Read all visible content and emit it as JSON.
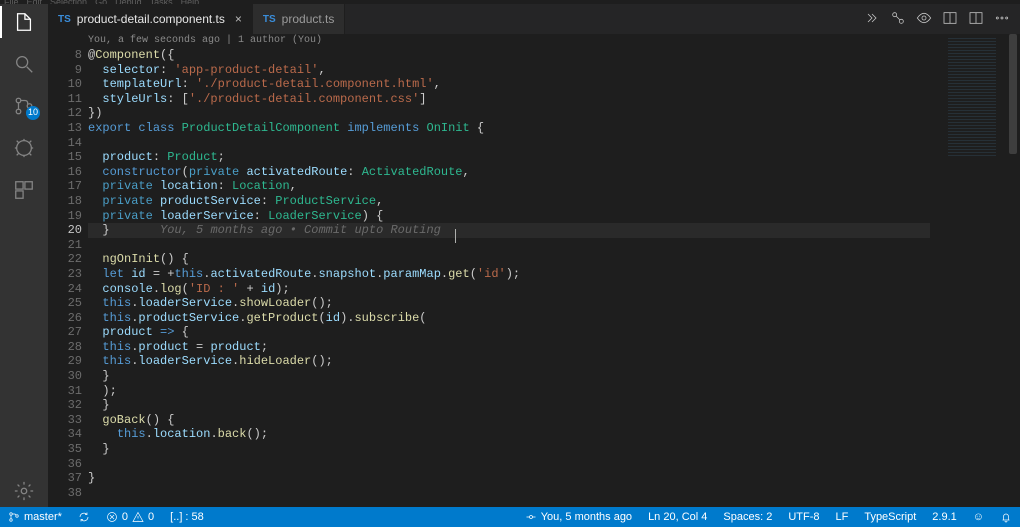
{
  "menu": [
    "File",
    "Edit",
    "Selection",
    "Go",
    "Debug",
    "Tasks",
    "Help"
  ],
  "activity_badge": "10",
  "tabs": [
    {
      "icon": "TS",
      "label": "product-detail.component.ts",
      "active": true
    },
    {
      "icon": "TS",
      "label": "product.ts",
      "active": false
    }
  ],
  "blame_top": "You, a few seconds ago | 1 author (You)",
  "cursor_blame": "You, 5 months ago • Commit upto Routing",
  "gutter_start": 8,
  "current_line": 20,
  "code": {
    "r8": [
      [
        "p",
        "@"
      ],
      [
        "fn",
        "Component"
      ],
      [
        "p",
        "({"
      ]
    ],
    "r9": [
      [
        "p",
        "  "
      ],
      [
        "id",
        "selector"
      ],
      [
        "p",
        ": "
      ],
      [
        "st",
        "'app-product-detail'"
      ],
      [
        "p",
        ","
      ]
    ],
    "r10": [
      [
        "p",
        "  "
      ],
      [
        "id",
        "templateUrl"
      ],
      [
        "p",
        ": "
      ],
      [
        "st",
        "'./product-detail.component.html'"
      ],
      [
        "p",
        ","
      ]
    ],
    "r11": [
      [
        "p",
        "  "
      ],
      [
        "id",
        "styleUrls"
      ],
      [
        "p",
        ": ["
      ],
      [
        "st",
        "'./product-detail.component.css'"
      ],
      [
        "p",
        "]"
      ]
    ],
    "r12": [
      [
        "p",
        "})"
      ]
    ],
    "r13": [
      [
        "k",
        "export"
      ],
      [
        "p",
        " "
      ],
      [
        "k",
        "class"
      ],
      [
        "p",
        " "
      ],
      [
        "cl",
        "ProductDetailComponent"
      ],
      [
        "p",
        " "
      ],
      [
        "k",
        "implements"
      ],
      [
        "p",
        " "
      ],
      [
        "cl",
        "OnInit"
      ],
      [
        "p",
        " {"
      ]
    ],
    "r14": [
      [
        "p",
        ""
      ]
    ],
    "r15": [
      [
        "p",
        "  "
      ],
      [
        "id",
        "product"
      ],
      [
        "p",
        ": "
      ],
      [
        "cl",
        "Product"
      ],
      [
        "p",
        ";"
      ]
    ],
    "r16": [
      [
        "p",
        "  "
      ],
      [
        "k",
        "constructor"
      ],
      [
        "p",
        "("
      ],
      [
        "kw",
        "private"
      ],
      [
        "p",
        " "
      ],
      [
        "id",
        "activatedRoute"
      ],
      [
        "p",
        ": "
      ],
      [
        "cl",
        "ActivatedRoute"
      ],
      [
        "p",
        ","
      ]
    ],
    "r17": [
      [
        "p",
        "  "
      ],
      [
        "kw",
        "private"
      ],
      [
        "p",
        " "
      ],
      [
        "id",
        "location"
      ],
      [
        "p",
        ": "
      ],
      [
        "cl",
        "Location"
      ],
      [
        "p",
        ","
      ]
    ],
    "r18": [
      [
        "p",
        "  "
      ],
      [
        "kw",
        "private"
      ],
      [
        "p",
        " "
      ],
      [
        "id",
        "productService"
      ],
      [
        "p",
        ": "
      ],
      [
        "cl",
        "ProductService"
      ],
      [
        "p",
        ","
      ]
    ],
    "r19": [
      [
        "p",
        "  "
      ],
      [
        "kw",
        "private"
      ],
      [
        "p",
        " "
      ],
      [
        "id",
        "loaderService"
      ],
      [
        "p",
        ": "
      ],
      [
        "cl",
        "LoaderService"
      ],
      [
        "p",
        ") {"
      ]
    ],
    "r20": [
      [
        "p",
        "  }"
      ],
      [
        "p",
        "       "
      ],
      [
        "cm-inline",
        "__BLAME__"
      ]
    ],
    "r21": [
      [
        "p",
        ""
      ]
    ],
    "r22": [
      [
        "p",
        "  "
      ],
      [
        "fn",
        "ngOnInit"
      ],
      [
        "p",
        "() {"
      ]
    ],
    "r23": [
      [
        "p",
        "  "
      ],
      [
        "k",
        "let"
      ],
      [
        "p",
        " "
      ],
      [
        "id",
        "id"
      ],
      [
        "p",
        " = +"
      ],
      [
        "this",
        "this"
      ],
      [
        "p",
        "."
      ],
      [
        "id",
        "activatedRoute"
      ],
      [
        "p",
        "."
      ],
      [
        "id",
        "snapshot"
      ],
      [
        "p",
        "."
      ],
      [
        "id",
        "paramMap"
      ],
      [
        "p",
        "."
      ],
      [
        "fn",
        "get"
      ],
      [
        "p",
        "("
      ],
      [
        "st",
        "'id'"
      ],
      [
        "p",
        ");"
      ]
    ],
    "r24": [
      [
        "p",
        "  "
      ],
      [
        "id",
        "console"
      ],
      [
        "p",
        "."
      ],
      [
        "fn",
        "log"
      ],
      [
        "p",
        "("
      ],
      [
        "st",
        "'ID : '"
      ],
      [
        "p",
        " + "
      ],
      [
        "id",
        "id"
      ],
      [
        "p",
        ");"
      ]
    ],
    "r25": [
      [
        "p",
        "  "
      ],
      [
        "this",
        "this"
      ],
      [
        "p",
        "."
      ],
      [
        "id",
        "loaderService"
      ],
      [
        "p",
        "."
      ],
      [
        "fn",
        "showLoader"
      ],
      [
        "p",
        "();"
      ]
    ],
    "r26": [
      [
        "p",
        "  "
      ],
      [
        "this",
        "this"
      ],
      [
        "p",
        "."
      ],
      [
        "id",
        "productService"
      ],
      [
        "p",
        "."
      ],
      [
        "fn",
        "getProduct"
      ],
      [
        "p",
        "("
      ],
      [
        "id",
        "id"
      ],
      [
        "p",
        ")."
      ],
      [
        "fn",
        "subscribe"
      ],
      [
        "p",
        "("
      ]
    ],
    "r27": [
      [
        "p",
        "  "
      ],
      [
        "id",
        "product"
      ],
      [
        "p",
        " "
      ],
      [
        "k",
        "=>"
      ],
      [
        "p",
        " {"
      ]
    ],
    "r28": [
      [
        "p",
        "  "
      ],
      [
        "this",
        "this"
      ],
      [
        "p",
        "."
      ],
      [
        "id",
        "product"
      ],
      [
        "p",
        " = "
      ],
      [
        "id",
        "product"
      ],
      [
        "p",
        ";"
      ]
    ],
    "r29": [
      [
        "p",
        "  "
      ],
      [
        "this",
        "this"
      ],
      [
        "p",
        "."
      ],
      [
        "id",
        "loaderService"
      ],
      [
        "p",
        "."
      ],
      [
        "fn",
        "hideLoader"
      ],
      [
        "p",
        "();"
      ]
    ],
    "r30": [
      [
        "p",
        "  }"
      ]
    ],
    "r31": [
      [
        "p",
        "  );"
      ]
    ],
    "r32": [
      [
        "p",
        "  }"
      ]
    ],
    "r33": [
      [
        "p",
        "  "
      ],
      [
        "fn",
        "goBack"
      ],
      [
        "p",
        "() {"
      ]
    ],
    "r34": [
      [
        "p",
        "    "
      ],
      [
        "this",
        "this"
      ],
      [
        "p",
        "."
      ],
      [
        "id",
        "location"
      ],
      [
        "p",
        "."
      ],
      [
        "fn",
        "back"
      ],
      [
        "p",
        "();"
      ]
    ],
    "r35": [
      [
        "p",
        "  }"
      ]
    ],
    "r36": [
      [
        "p",
        ""
      ]
    ],
    "r37": [
      [
        "p",
        "}"
      ]
    ],
    "r38": [
      [
        "p",
        ""
      ]
    ]
  },
  "status": {
    "branch": "master*",
    "sync": "",
    "errors": "0",
    "warnings": "0",
    "info": "[..] : 58",
    "blame": "You, 5 months ago",
    "ln_col": "Ln 20, Col 4",
    "spaces": "Spaces: 2",
    "encoding": "UTF-8",
    "eol": "LF",
    "language": "TypeScript",
    "ts_version": "2.9.1",
    "feedback": "☺"
  }
}
